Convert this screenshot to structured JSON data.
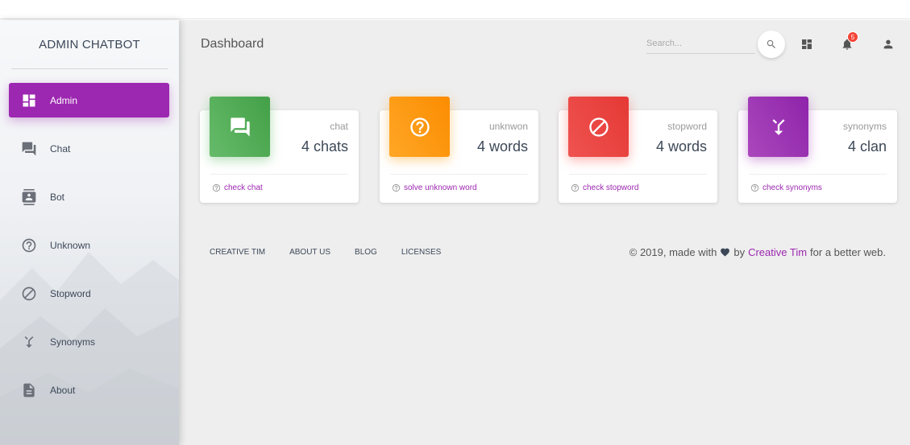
{
  "sidebar": {
    "brand": "ADMIN CHATBOT",
    "items": [
      {
        "label": "Admin",
        "icon": "dashboard-icon",
        "active": true
      },
      {
        "label": "Chat",
        "icon": "chat-icon"
      },
      {
        "label": "Bot",
        "icon": "contact-card-icon"
      },
      {
        "label": "Unknown",
        "icon": "help-circle-icon"
      },
      {
        "label": "Stopword",
        "icon": "block-icon"
      },
      {
        "label": "Synonyms",
        "icon": "merge-icon"
      },
      {
        "label": "About",
        "icon": "document-icon"
      }
    ]
  },
  "header": {
    "title": "Dashboard",
    "search_placeholder": "Search...",
    "notification_count": "5"
  },
  "cards": [
    {
      "category": "chat",
      "value": "4 chats",
      "footer": "check chat",
      "color": "#4caf50",
      "icon": "forum-icon"
    },
    {
      "category": "unknwon",
      "value": "4 words",
      "footer": "solve unknown word",
      "color": "#ff9800",
      "icon": "help-circle-icon"
    },
    {
      "category": "stopword",
      "value": "4 words",
      "footer": "check stopword",
      "color": "#f44336",
      "icon": "block-icon"
    },
    {
      "category": "synonyms",
      "value": "4 clan",
      "footer": "check synonyms",
      "color": "#9c27b0",
      "icon": "merge-icon"
    }
  ],
  "footer": {
    "links": [
      "CREATIVE TIM",
      "ABOUT US",
      "BLOG",
      "LICENSES"
    ],
    "copyright_prefix": "© 2019, made with",
    "copyright_by": "by",
    "copyright_brand": "Creative Tim",
    "copyright_suffix": "for a better web."
  },
  "colors": {
    "accent": "#9c27b0",
    "green": "#4caf50",
    "orange": "#ff9800",
    "red": "#f44336"
  }
}
